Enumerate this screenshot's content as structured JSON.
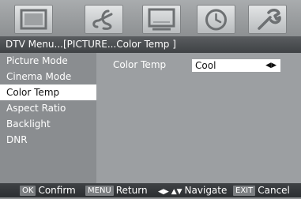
{
  "menu_icons": [
    {
      "name": "picture-icon",
      "active": false
    },
    {
      "name": "audio-icon",
      "active": false
    },
    {
      "name": "screen-icon",
      "active": false
    },
    {
      "name": "clock-icon",
      "active": false
    },
    {
      "name": "setup-wrench-icon",
      "active": false
    }
  ],
  "breadcrumb": "DTV Menu...[PICTURE...Color Temp ]",
  "sidebar": {
    "items": [
      {
        "label": "Picture Mode"
      },
      {
        "label": "Cinema Mode"
      },
      {
        "label": "Color Temp"
      },
      {
        "label": "Aspect Ratio"
      },
      {
        "label": "Backlight"
      },
      {
        "label": "DNR"
      }
    ],
    "selected_index": 2
  },
  "setting": {
    "label": "Color Temp",
    "value": "Cool",
    "arrows": "◀▶"
  },
  "footer": {
    "confirm_key": "OK",
    "confirm_label": "Confirm",
    "return_key": "MENU",
    "return_label": "Return",
    "navigate_glyph": "◀▶ ▲▼",
    "navigate_label": "Navigate",
    "cancel_key": "EXIT",
    "cancel_label": "Cancel"
  }
}
